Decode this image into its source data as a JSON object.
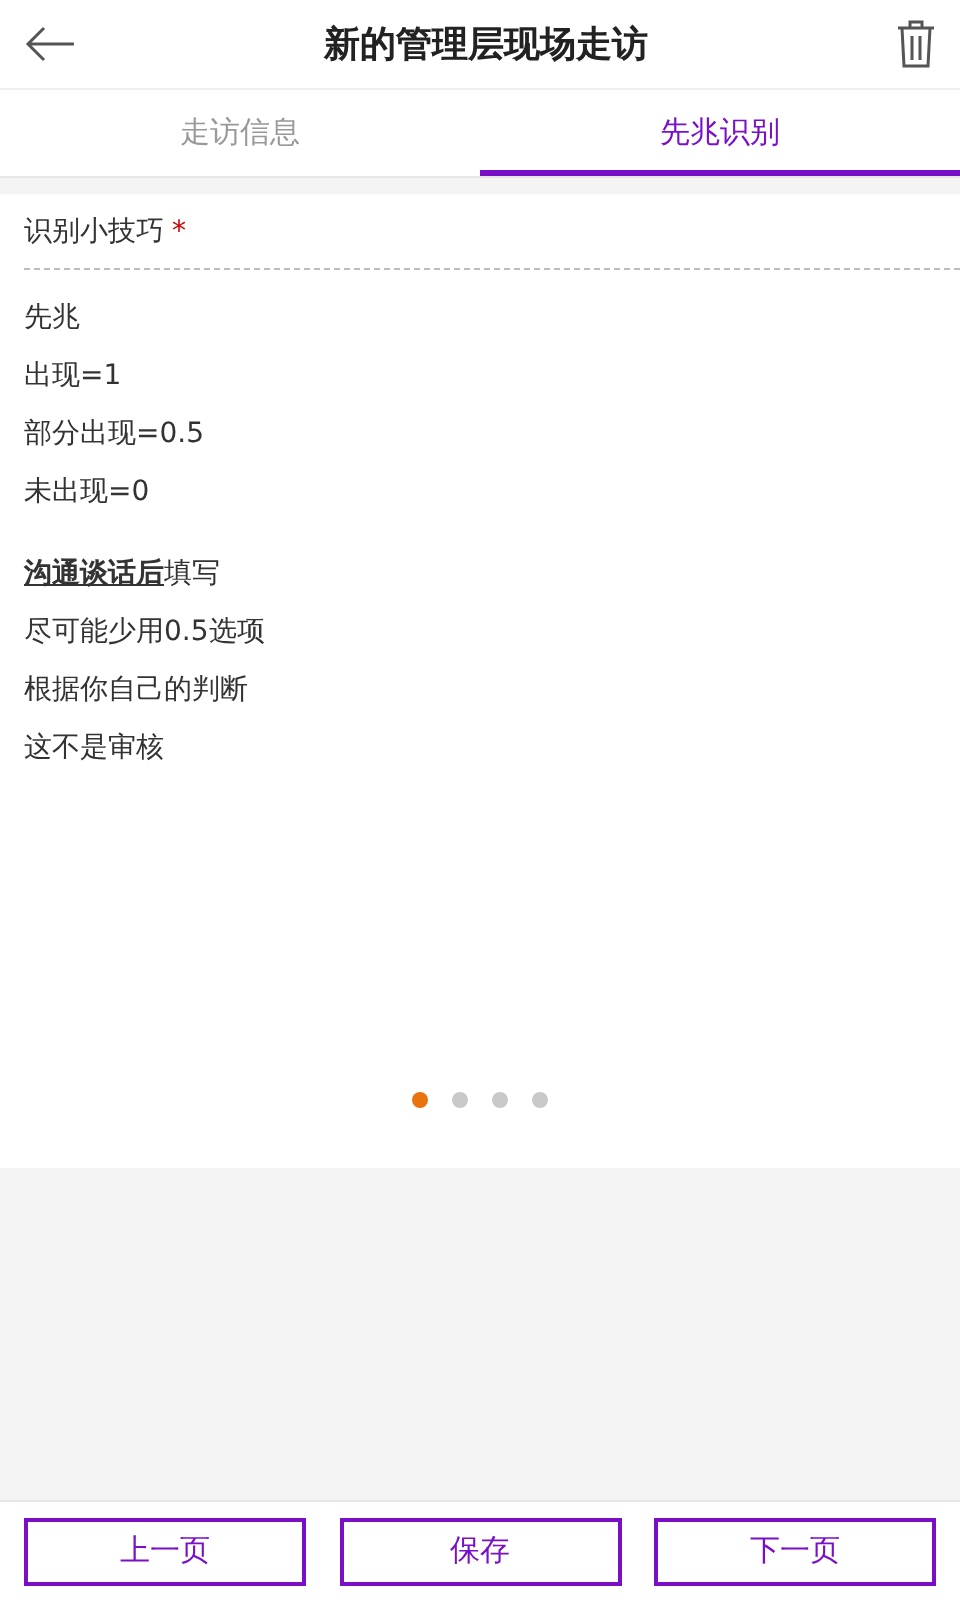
{
  "header": {
    "title": "新的管理层现场走访"
  },
  "tabs": [
    {
      "label": "走访信息",
      "selected": false
    },
    {
      "label": "先兆识别",
      "selected": true
    }
  ],
  "card": {
    "label": "识别小技巧",
    "required_mark": "*",
    "groups": [
      [
        "先兆",
        "出现=1",
        "部分出现=0.5",
        "未出现=0"
      ],
      [
        "**沟通谈话后**填写",
        "尽可能少用0.5选项",
        "根据你自己的判断",
        "这不是审核"
      ]
    ]
  },
  "pager": [
    {
      "selected": true
    },
    {
      "selected": false
    },
    {
      "selected": false
    },
    {
      "selected": false
    }
  ],
  "buttons": [
    "上一页",
    "保存",
    "下一页"
  ]
}
